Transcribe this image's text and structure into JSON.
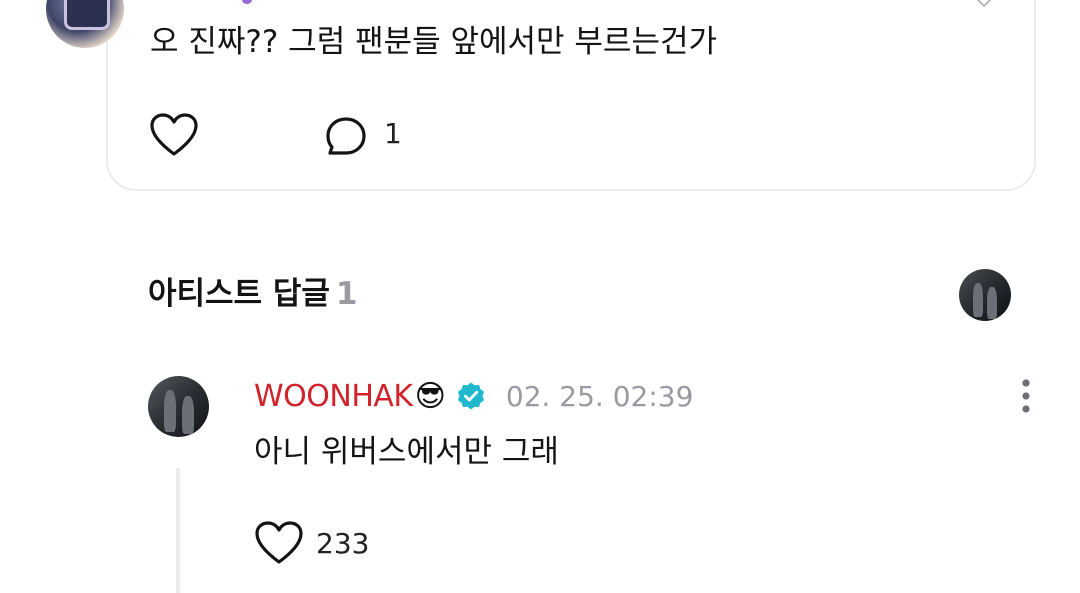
{
  "post": {
    "text": "오 진짜?? 그럼 팬분들 앞에서만 부르는건가",
    "reply_count": "1"
  },
  "artist_replies": {
    "title": "아티스트 답글",
    "count": "1"
  },
  "reply": {
    "author": "WOONHAK",
    "author_emoji": "😎",
    "timestamp": "02. 25. 02:39",
    "text": "아니 위버스에서만 그래",
    "like_count": "233"
  },
  "colors": {
    "author_name": "#d0232b",
    "verified_badge": "#1fb8cc",
    "card_border": "#ececef",
    "muted_text": "#9a9aa0"
  },
  "icons": {
    "like": "heart-outline-icon",
    "reply": "speech-bubble-icon",
    "verified": "verified-badge-icon",
    "more": "more-vertical-icon"
  }
}
